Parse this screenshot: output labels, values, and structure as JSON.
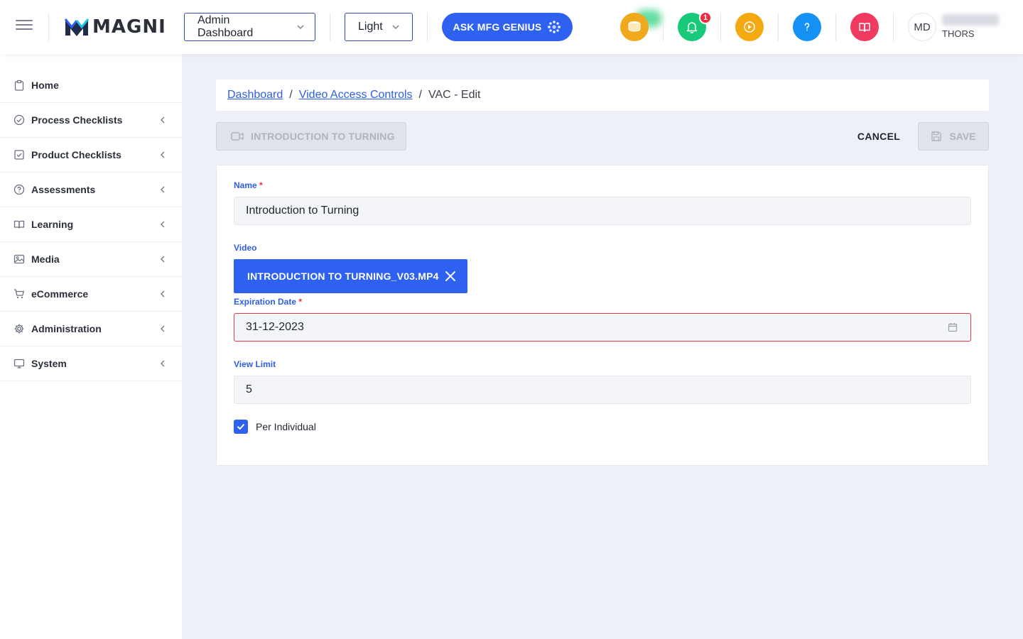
{
  "header": {
    "logo_text": "MAGNI",
    "dashboard_select": "Admin Dashboard",
    "theme_select": "Light",
    "genius_button": "ASK MFG GENIUS",
    "notification_count": "1",
    "avatar_initials": "MD",
    "user_org": "THORS",
    "colors": {
      "coins": "#f0a81c",
      "bell": "#19c97a",
      "play": "#f5a910",
      "help": "#1590f5",
      "book": "#f03a60",
      "accent": "#2e61f0"
    }
  },
  "sidebar": {
    "items": [
      {
        "label": "Home",
        "icon": "clipboard-icon"
      },
      {
        "label": "Process Checklists",
        "icon": "check-circle-icon"
      },
      {
        "label": "Product Checklists",
        "icon": "check-square-icon"
      },
      {
        "label": "Assessments",
        "icon": "question-circle-icon"
      },
      {
        "label": "Learning",
        "icon": "book-open-icon"
      },
      {
        "label": "Media",
        "icon": "image-icon"
      },
      {
        "label": "eCommerce",
        "icon": "cart-icon"
      },
      {
        "label": "Administration",
        "icon": "gear-icon"
      },
      {
        "label": "System",
        "icon": "monitor-icon"
      }
    ]
  },
  "breadcrumb": {
    "items": [
      "Dashboard",
      "Video Access Controls",
      "VAC - Edit"
    ],
    "separator": "/"
  },
  "toolbar": {
    "video_title": "INTRODUCTION TO TURNING",
    "cancel_label": "CANCEL",
    "save_label": "SAVE"
  },
  "form": {
    "name_label": "Name",
    "required_mark": "*",
    "name_value": "Introduction to Turning",
    "video_label": "Video",
    "video_file": "INTRODUCTION TO TURNING_V03.MP4",
    "expiration_label": "Expiration Date",
    "expiration_value": "31-12-2023",
    "view_limit_label": "View Limit",
    "view_limit_value": "5",
    "per_individual_label": "Per Individual",
    "per_individual_checked": true
  }
}
